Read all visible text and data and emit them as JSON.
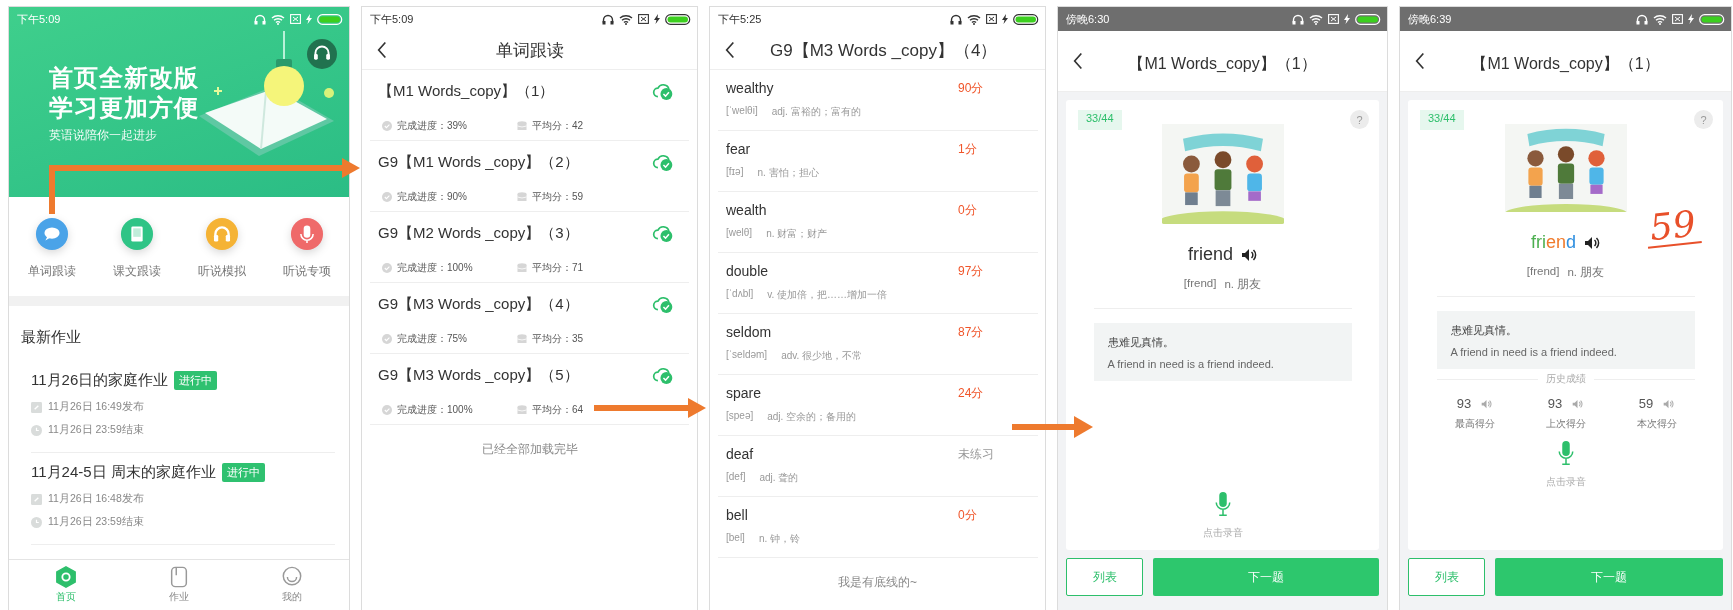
{
  "home": {
    "status_time": "下午5:09",
    "banner": {
      "title_lines": [
        "首页全新改版",
        "学习更加方便"
      ],
      "subtitle": "英语说陪你一起进步"
    },
    "shortcuts": [
      {
        "label": "单词跟读",
        "kind": "chat",
        "color": "#4aa3e8"
      },
      {
        "label": "课文跟读",
        "kind": "book",
        "color": "#2fc486"
      },
      {
        "label": "听说模拟",
        "kind": "headphones",
        "color": "#f5b335"
      },
      {
        "label": "听说专项",
        "kind": "mic",
        "color": "#ef6a6a"
      }
    ],
    "section_title": "最新作业",
    "assignments": [
      {
        "title": "11月26日的家庭作业",
        "status": "进行中",
        "published": "11月26日 16:49发布",
        "due": "11月26日 23:59结束"
      },
      {
        "title": "11月24-5日 周末的家庭作业",
        "status": "进行中",
        "published": "11月26日 16:48发布",
        "due": "11月26日 23:59结束"
      }
    ],
    "nav": [
      {
        "label": "首页",
        "kind": "home",
        "selected": true
      },
      {
        "label": "作业",
        "kind": "homework",
        "selected": false
      },
      {
        "label": "我的",
        "kind": "me",
        "selected": false
      }
    ]
  },
  "unit_list": {
    "status_time": "下午5:09",
    "title": "单词跟读",
    "units": [
      {
        "name": "【M1 Words_copy】（1）",
        "progress": "完成进度：39%",
        "average": "平均分：42"
      },
      {
        "name": "G9【M1 Words _copy】（2）",
        "progress": "完成进度：90%",
        "average": "平均分：59"
      },
      {
        "name": "G9【M2 Words _copy】（3）",
        "progress": "完成进度：100%",
        "average": "平均分：71"
      },
      {
        "name": "G9【M3 Words  _copy】（4）",
        "progress": "完成进度：75%",
        "average": "平均分：35"
      },
      {
        "name": "G9【M3 Words  _copy】（5）",
        "progress": "完成进度：100%",
        "average": "平均分：64"
      }
    ],
    "footer": "已经全部加载完毕"
  },
  "word_list": {
    "status_time": "下午5:25",
    "title": "G9【M3 Words  _copy】（4）",
    "words": [
      {
        "word": "wealthy",
        "phonetic": "[ˈwelθi]",
        "meaning": "adj. 富裕的；富有的",
        "score": "90分",
        "practiced": true
      },
      {
        "word": "fear",
        "phonetic": "[fɪə]",
        "meaning": "n. 害怕；担心",
        "score": "1分",
        "practiced": true
      },
      {
        "word": "wealth",
        "phonetic": "[welθ]",
        "meaning": "n. 财富；财产",
        "score": "0分",
        "practiced": true
      },
      {
        "word": "double",
        "phonetic": "[ˈdʌbl]",
        "meaning": "v. 使加倍，把……增加一倍",
        "score": "97分",
        "practiced": true
      },
      {
        "word": "seldom",
        "phonetic": "[ˈseldəm]",
        "meaning": "adv. 很少地，不常",
        "score": "87分",
        "practiced": true
      },
      {
        "word": "spare",
        "phonetic": "[speə]",
        "meaning": "adj. 空余的；备用的",
        "score": "24分",
        "practiced": true
      },
      {
        "word": "deaf",
        "phonetic": "[def]",
        "meaning": "adj. 聋的",
        "score": "未练习",
        "practiced": false
      },
      {
        "word": "bell",
        "phonetic": "[bel]",
        "meaning": "n. 钟，铃",
        "score": "0分",
        "practiced": true
      }
    ],
    "footer": "我是有底线的~"
  },
  "practice": {
    "status_time": "傍晚6:30",
    "title": "【M1 Words_copy】（1）",
    "counter": "33/44",
    "help": "?",
    "word": "friend",
    "phonetic": "[frend]",
    "meaning": "n. 朋友",
    "sentence_cn": "患难见真情。",
    "sentence_en": "A friend in need is a friend indeed.",
    "record_hint": "点击录音",
    "list_button": "列表",
    "next_button": "下一题"
  },
  "result": {
    "status_time": "傍晚6:39",
    "title": "【M1 Words_copy】（1）",
    "counter": "33/44",
    "help": "?",
    "word_segments": [
      {
        "text": "fri",
        "color": "#4caf50"
      },
      {
        "text": "en",
        "color": "#f07b2c"
      },
      {
        "text": "d",
        "color": "#2f8fe0"
      }
    ],
    "score": "59",
    "phonetic": "[frend]",
    "meaning": "n. 朋友",
    "sentence_cn": "患难见真情。",
    "sentence_en": "A friend in need is a friend indeed.",
    "history_label": "历史成绩",
    "history": [
      {
        "score": "93",
        "label": "最高得分"
      },
      {
        "score": "93",
        "label": "上次得分"
      },
      {
        "score": "59",
        "label": "本次得分"
      }
    ],
    "record_hint": "点击录音",
    "list_button": "列表",
    "next_button": "下一题"
  }
}
